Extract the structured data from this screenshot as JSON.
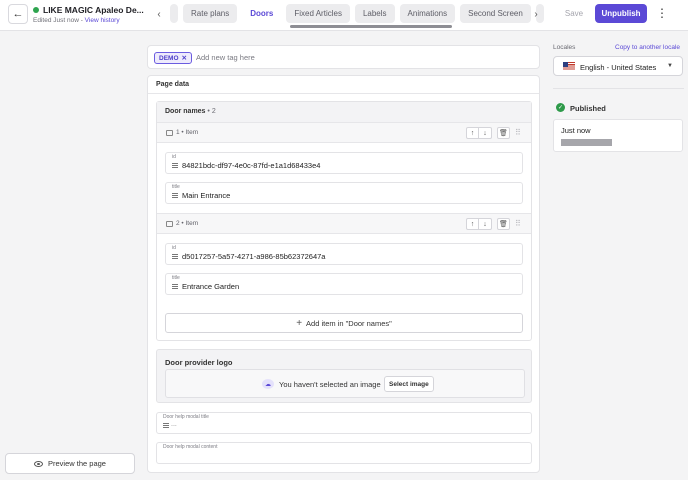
{
  "header": {
    "title": "LIKE MAGIC Apaleo De...",
    "edited_text": "Edited Just now",
    "separator": " - ",
    "view_history": "View history",
    "tabs": [
      {
        "label": ""
      },
      {
        "label": "Rate plans"
      },
      {
        "label": "Doors"
      },
      {
        "label": "Fixed Articles"
      },
      {
        "label": "Labels"
      },
      {
        "label": "Animations"
      },
      {
        "label": "Second Screen"
      },
      {
        "label": ""
      }
    ],
    "save_label": "Save",
    "unpublish_label": "Unpublish"
  },
  "tags": {
    "chip_label": "DEMO",
    "placeholder": "Add new tag here"
  },
  "page_data": {
    "title": "Page data",
    "door_names": {
      "title": "Door names",
      "count_text": "• 2",
      "items": [
        {
          "label": "1 • Item",
          "id_label": "id",
          "id_value": "84821bdc-df97-4e0c-87fd-e1a1d68433e4",
          "title_label": "title",
          "title_value": "Main Entrance"
        },
        {
          "label": "2 • Item",
          "id_label": "id",
          "id_value": "d5017257-5a57-4271-a986-85b62372647a",
          "title_label": "title",
          "title_value": "Entrance Garden"
        }
      ],
      "add_item_label": "Add item in \"Door names\""
    },
    "door_provider_logo": {
      "title": "Door provider logo",
      "empty_text": "You haven't selected an image",
      "select_label": "Select image"
    },
    "modal_title": {
      "label": "Door help modal title",
      "value": "..."
    },
    "modal_content": {
      "label": "Door help modal content",
      "value": ""
    }
  },
  "preview_label": "Preview the page",
  "right_panel": {
    "locales_label": "Locales",
    "copy_link": "Copy to another locale",
    "locale_value": "English - United States",
    "status": "Published",
    "published_time": "Just now"
  },
  "colors": {
    "accent": "#5b49d6",
    "published_green": "#2e9a4a",
    "status_dot": "#2ea44f"
  }
}
